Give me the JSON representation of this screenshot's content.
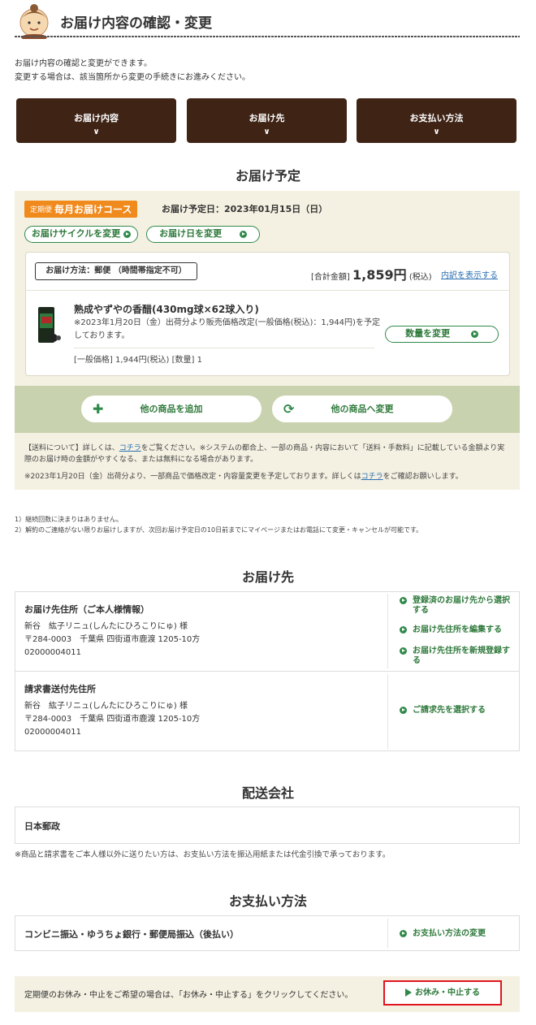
{
  "header": {
    "title": "お届け内容の確認・変更"
  },
  "intro": {
    "line1": "お届け内容の確認と変更ができます。",
    "line2": "変更する場合は、該当箇所から変更の手続きにお進みください。"
  },
  "nav": [
    {
      "label": "お届け内容"
    },
    {
      "label": "お届け先"
    },
    {
      "label": "お支払い方法"
    }
  ],
  "schedule": {
    "title": "お届け予定",
    "badge_small": "定期便",
    "badge_big": "毎月お届けコース",
    "date_label": "お届け予定日：2023年01月15日（日）",
    "change_cycle": "お届けサイクルを変更",
    "change_date": "お届け日を変更",
    "method": "お届け方法：郵便 （時間帯指定不可）",
    "total_prefix": "[合計金額]",
    "total_amount": "1,859円",
    "total_suffix": "(税込)",
    "detail_link": "内訳を表示する",
    "product": {
      "name": "熟成やずやの香醋(430mg球×62球入り)",
      "note": "※2023年1月20日（金）出荷分より販売価格改定(一般価格(税込)：1,944円)を予定しております。",
      "price_line": "[一般価格] 1,944円(税込) [数量] 1",
      "qty_button": "数量を変更"
    },
    "add_button": "他の商品を追加",
    "swap_button": "他の商品へ変更",
    "ship_note_a": "【送料について】詳しくは、",
    "ship_note_link": "コチラ",
    "ship_note_b": "をご覧ください。※システムの都合上、一部の商品・内容において「送料・手数料」に記載している金額より実際のお届け時の金額がやすくなる、または無料になる場合があります。",
    "price_note_a": "※2023年1月20日（金）出荷分より、一部商品で価格改定・内容量変更を予定しております。詳しくは",
    "price_note_link": "コチラ",
    "price_note_b": "をご確認お願いします。"
  },
  "footnotes": {
    "f1": "1）継続回数に決まりはありません。",
    "f2": "2）解約のご連絡がない限りお届けしますが、次回お届け予定日の10日前までにマイページまたはお電話にて変更・キャンセルが可能です。"
  },
  "address": {
    "title": "お届け先",
    "ship_head": "お届け先住所（ご本人様情報）",
    "ship_name": "新谷　紘子リニュ(しんたにひろこりにゅ) 様",
    "ship_addr": "〒284-0003　千葉県 四街道市鹿渡 1205-10方",
    "ship_tel": "02000004011",
    "link_select": "登録済のお届け先から選択する",
    "link_edit": "お届け先住所を編集する",
    "link_new": "お届け先住所を新規登録する",
    "bill_head": "請求書送付先住所",
    "bill_name": "新谷　紘子リニュ(しんたにひろこりにゅ) 様",
    "bill_addr": "〒284-0003　千葉県 四街道市鹿渡 1205-10方",
    "bill_tel": "02000004011",
    "link_bill": "ご請求先を選択する"
  },
  "carrier": {
    "title": "配送会社",
    "name": "日本郵政",
    "note": "※商品と請求書をご本人様以外に送りたい方は、お支払い方法を振込用紙または代金引換で承っております。"
  },
  "payment": {
    "title": "お支払い方法",
    "method": "コンビニ振込・ゆうちょ銀行・郵便局振込（後払い）",
    "change_link": "お支払い方法の変更"
  },
  "stop": {
    "text": "定期便のお休み・中止をご希望の場合は、「お休み・中止する」をクリックしてください。",
    "button": "お休み・中止する"
  }
}
